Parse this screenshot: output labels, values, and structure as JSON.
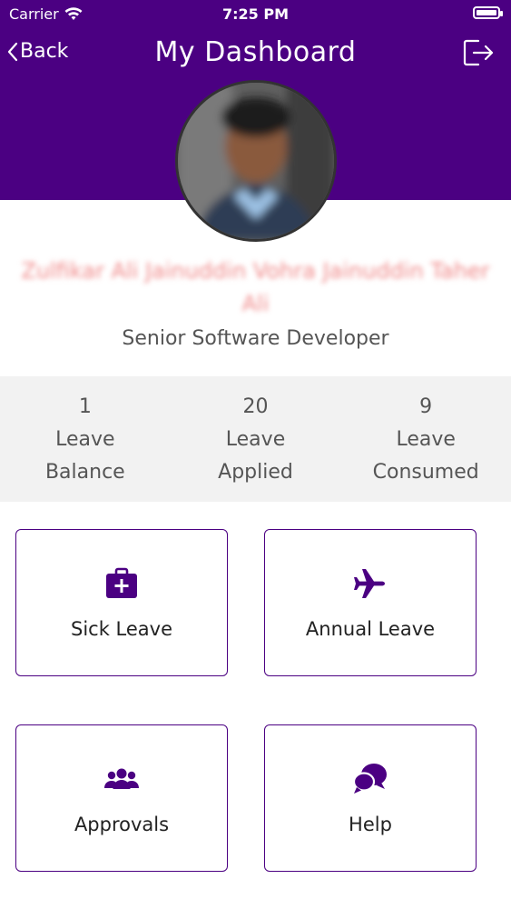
{
  "status_bar": {
    "carrier": "Carrier",
    "time": "7:25 PM"
  },
  "nav": {
    "back_label": "Back",
    "title": "My Dashboard"
  },
  "profile": {
    "name": "Zulfikar Ali Jainuddin Vohra Jainuddin Taher Ali",
    "role": "Senior Software Developer"
  },
  "stats": [
    {
      "value": "1",
      "label": "Leave\nBalance"
    },
    {
      "value": "20",
      "label": "Leave\nApplied"
    },
    {
      "value": "9",
      "label": "Leave\nConsumed"
    }
  ],
  "tiles": [
    {
      "label": "Sick Leave",
      "icon": "medical-kit-icon"
    },
    {
      "label": "Annual Leave",
      "icon": "airplane-icon"
    },
    {
      "label": "Approvals",
      "icon": "users-icon"
    },
    {
      "label": "Help",
      "icon": "chat-bubbles-icon"
    }
  ],
  "colors": {
    "primary": "#4b0082",
    "stats_bg": "#f2f2f2"
  }
}
